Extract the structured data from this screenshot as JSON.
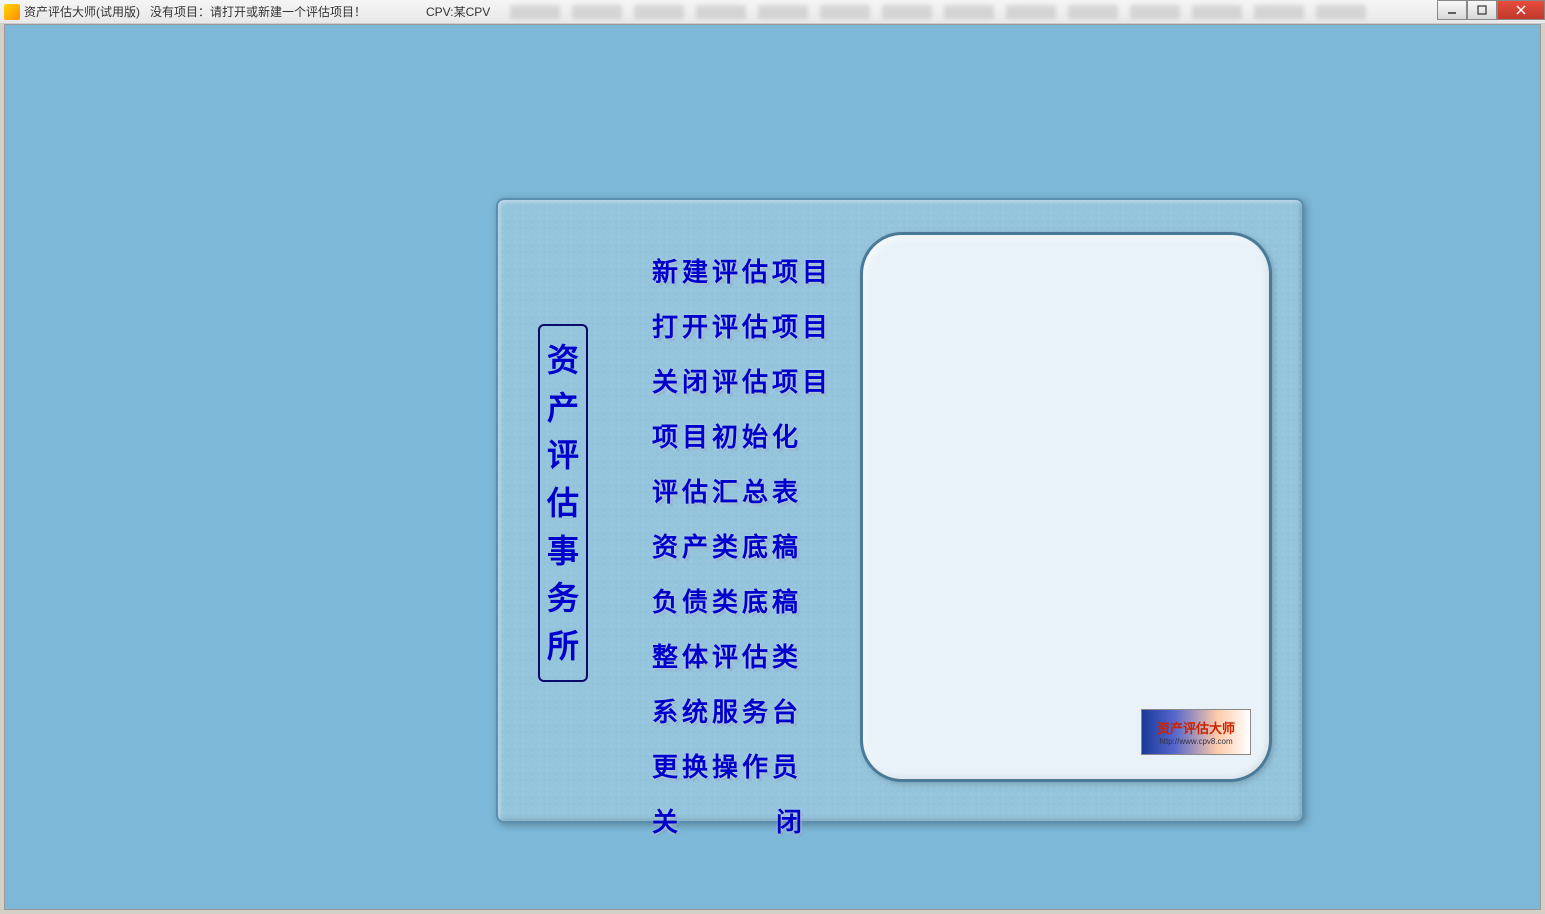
{
  "titlebar": {
    "app_name": "资产评估大师(试用版)",
    "status": "没有项目：请打开或新建一个评估项目！",
    "cpv": "CPV:某CPV"
  },
  "panel": {
    "vertical_title_chars": [
      "资",
      "产",
      "评",
      "估",
      "事",
      "务",
      "所"
    ],
    "menu": [
      "新建评估项目",
      "打开评估项目",
      "关闭评估项目",
      "项目初始化",
      "评估汇总表",
      "资产类底稿",
      "负债类底稿",
      "整体评估类",
      "系统服务台",
      "更换操作员"
    ],
    "close_label_left": "关",
    "close_label_right": "闭",
    "logo_text": "资产评估大师",
    "logo_url": "http://www.cpv8.com"
  }
}
